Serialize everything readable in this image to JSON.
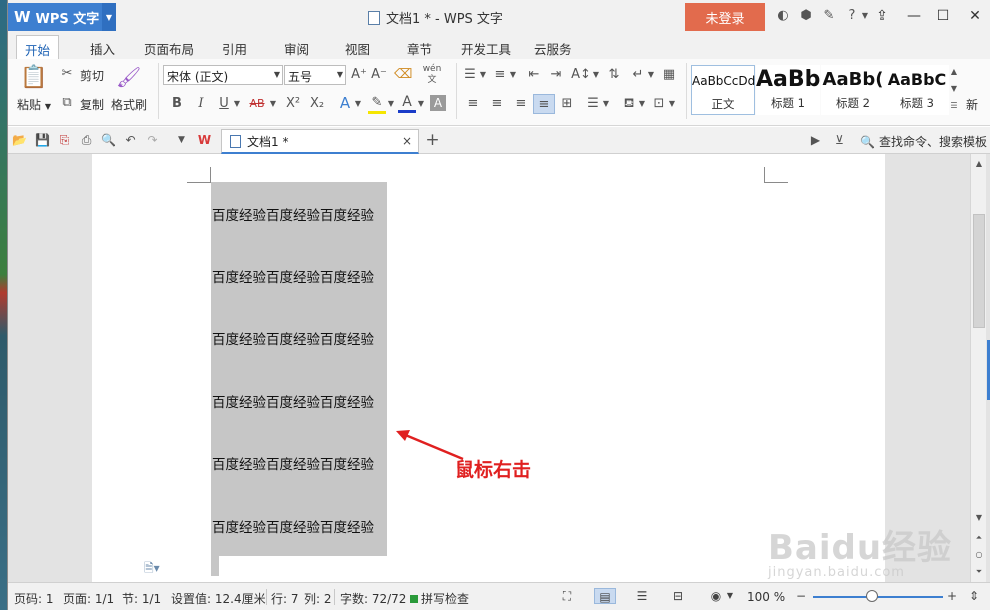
{
  "titlebar": {
    "app_name": "WPS 文字",
    "app_logo": "W",
    "document_title": "文档1 * - WPS 文字",
    "login_label": "未登录",
    "help_glyph": "?"
  },
  "menu": {
    "tabs": [
      "开始",
      "插入",
      "页面布局",
      "引用",
      "审阅",
      "视图",
      "章节",
      "开发工具",
      "云服务"
    ],
    "active_tab": "开始"
  },
  "ribbon": {
    "clipboard": {
      "paste": "粘贴",
      "cut": "剪切",
      "copy": "复制",
      "format_painter": "格式刷"
    },
    "font": {
      "family": "宋体 (正文)",
      "size": "五号",
      "grow_glyph": "A⁺",
      "shrink_glyph": "A⁻",
      "bold": "B",
      "italic": "I",
      "underline": "U",
      "strike": "AB",
      "superscript": "X²",
      "subscript": "X₂",
      "effects": "A",
      "font_color": "A",
      "char_shading": "A",
      "phonetic": "wén 文"
    },
    "styles": [
      {
        "sample": "AaBbCcDd",
        "caption": "正文"
      },
      {
        "sample": "AaBb",
        "caption": "标题 1"
      },
      {
        "sample": "AaBb(",
        "caption": "标题 2"
      },
      {
        "sample": "AaBbC",
        "caption": "标题 3"
      }
    ],
    "new_style": "新"
  },
  "tabbar": {
    "doc_tab": "文档1 *",
    "close_glyph": "×",
    "add_glyph": "+",
    "search_placeholder": "查找命令、搜索模板"
  },
  "document": {
    "lines": [
      "百度经验百度经验百度经验",
      "百度经验百度经验百度经验",
      "百度经验百度经验百度经验",
      "百度经验百度经验百度经验",
      "百度经验百度经验百度经验",
      "百度经验百度经验百度经验"
    ],
    "annotation": "鼠标右击"
  },
  "statusbar": {
    "page_code": "页码: 1",
    "page": "页面: 1/1",
    "section": "节: 1/1",
    "position": "设置值: 12.4厘米",
    "row": "行: 7",
    "col": "列: 2",
    "word_count": "字数: 72/72",
    "spell_check": "拼写检查",
    "zoom": "100 %",
    "zoom_fraction": 0.45
  },
  "watermark": {
    "main": "Baidu经验",
    "sub": "jingyan.baidu.com"
  },
  "colors": {
    "accent": "#3d7fd0",
    "login": "#e26b4d",
    "annotation": "#e02020",
    "selection": "#c6c6c6"
  }
}
